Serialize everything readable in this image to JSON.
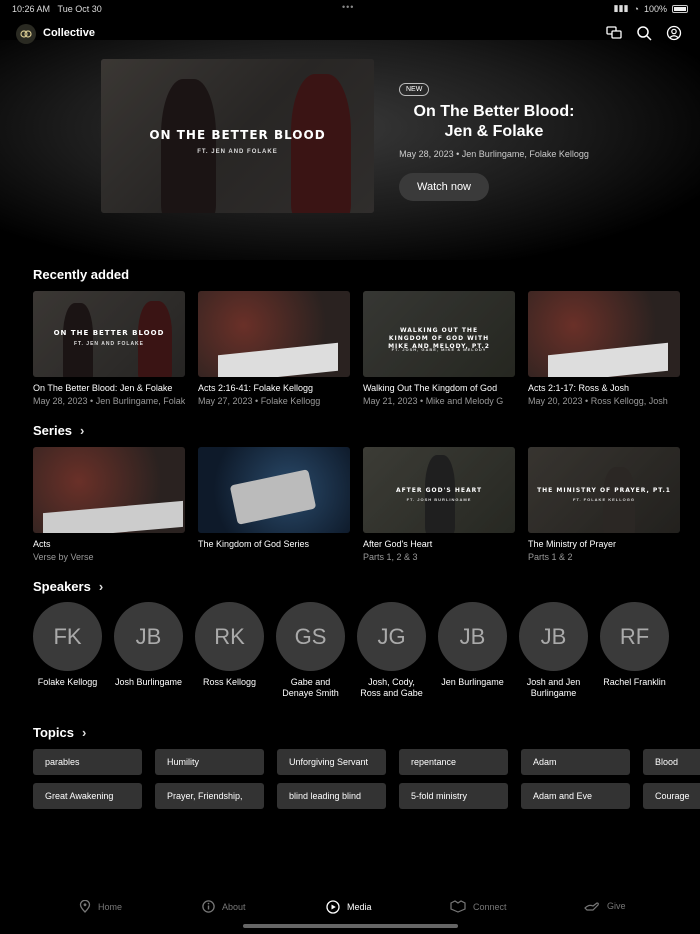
{
  "status": {
    "time": "10:26 AM",
    "date": "Tue Oct 30",
    "battery": "100%"
  },
  "app": {
    "brand": "Collective"
  },
  "hero": {
    "thumb_title": "ON THE BETTER BLOOD",
    "thumb_sub": "FT. JEN AND FOLAKE",
    "badge": "NEW",
    "title": "On The Better Blood: Jen & Folake",
    "meta": "May 28, 2023 • Jen Burlingame, Folake Kellogg",
    "cta": "Watch now"
  },
  "recent": {
    "heading": "Recently added",
    "items": [
      {
        "title": "On The Better Blood: Jen & Folake",
        "meta": "May 28, 2023 • Jen Burlingame, Folake Kellogg",
        "thumb_title": "ON THE BETTER BLOOD",
        "thumb_sub": "FT. JEN AND FOLAKE"
      },
      {
        "title": "Acts 2:16-41: Folake Kellogg",
        "meta": "May 27, 2023 • Folake Kellogg",
        "thumb_title": "",
        "thumb_sub": ""
      },
      {
        "title": "Walking Out The Kingdom of God",
        "meta": "May 21, 2023 • Mike and Melody G",
        "thumb_title": "WALKING OUT THE KINGDOM OF GOD WITH MIKE AND MELODY, PT.2",
        "thumb_sub": "FT. JOSH, GABE, MIKE & MELODY"
      },
      {
        "title": "Acts 2:1-17: Ross & Josh",
        "meta": "May 20, 2023 • Ross Kellogg, Josh",
        "thumb_title": "",
        "thumb_sub": ""
      }
    ]
  },
  "series": {
    "heading": "Series",
    "items": [
      {
        "title": "Acts",
        "meta": "Verse by Verse",
        "thumb_title": "",
        "thumb_sub": ""
      },
      {
        "title": "The Kingdom of God Series",
        "meta": "",
        "thumb_title": "",
        "thumb_sub": ""
      },
      {
        "title": "After God's Heart",
        "meta": "Parts 1, 2 & 3",
        "thumb_title": "AFTER GOD'S HEART",
        "thumb_sub": "FT. JOSH BURLINGAME"
      },
      {
        "title": "The Ministry of Prayer",
        "meta": "Parts 1 & 2",
        "thumb_title": "THE MINISTRY OF PRAYER, PT.1",
        "thumb_sub": "FT. FOLAKE KELLOGG"
      }
    ]
  },
  "speakers": {
    "heading": "Speakers",
    "items": [
      {
        "initials": "FK",
        "name": "Folake Kellogg"
      },
      {
        "initials": "JB",
        "name": "Josh Burlingame"
      },
      {
        "initials": "RK",
        "name": "Ross Kellogg"
      },
      {
        "initials": "GS",
        "name": "Gabe and Denaye Smith"
      },
      {
        "initials": "JG",
        "name": "Josh, Cody, Ross and Gabe"
      },
      {
        "initials": "JB",
        "name": "Jen Burlingame"
      },
      {
        "initials": "JB",
        "name": "Josh and Jen Burlingame"
      },
      {
        "initials": "RF",
        "name": "Rachel Franklin"
      }
    ]
  },
  "topics": {
    "heading": "Topics",
    "row1": [
      "parables",
      "Humility",
      "Unforgiving Servant",
      "repentance",
      "Adam",
      "Blood"
    ],
    "row2": [
      "Great Awakening",
      "Prayer, Friendship,",
      "blind leading blind",
      "5-fold ministry",
      "Adam and Eve",
      "Courage"
    ]
  },
  "tabs": {
    "home": "Home",
    "about": "About",
    "media": "Media",
    "connect": "Connect",
    "give": "Give"
  }
}
